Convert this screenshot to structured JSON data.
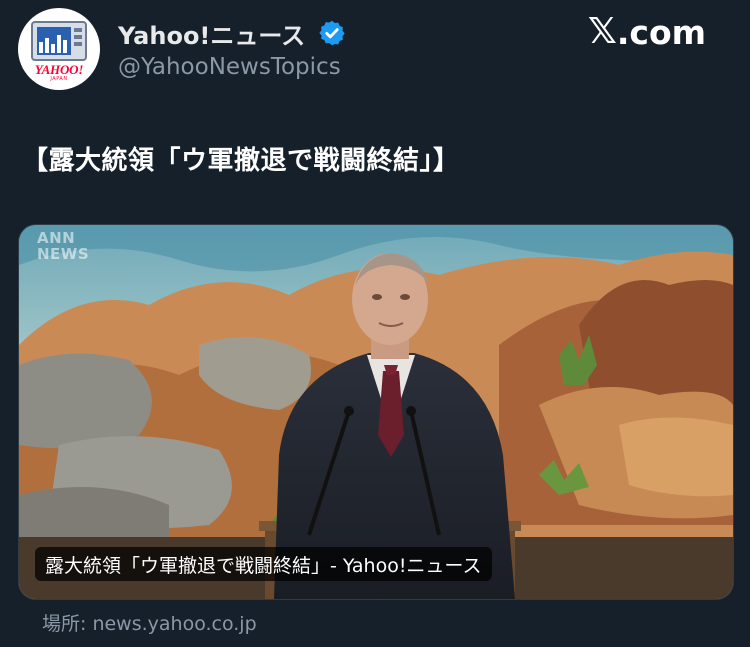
{
  "account": {
    "display_name": "Yahoo!ニュース",
    "handle": "@YahooNewsTopics",
    "avatar_logo": "YAHOO!",
    "avatar_sub": "JAPAN",
    "verified_icon": "verified-badge-icon"
  },
  "brand": {
    "x_glyph": "𝕏",
    "domain": ".com"
  },
  "post": {
    "text": "【露大統領「ウ軍撤退で戦闘終結」】"
  },
  "media": {
    "watermark_line1": "ANN",
    "watermark_line2": "NEWS",
    "caption": "露大統領「ウ軍撤退で戦闘終結」- Yahoo!ニュース",
    "source": "場所: news.yahoo.co.jp"
  },
  "colors": {
    "background": "#15202b",
    "verified": "#1d9bf0",
    "secondary_text": "#8b98a5",
    "logo_red": "#ff0033"
  }
}
